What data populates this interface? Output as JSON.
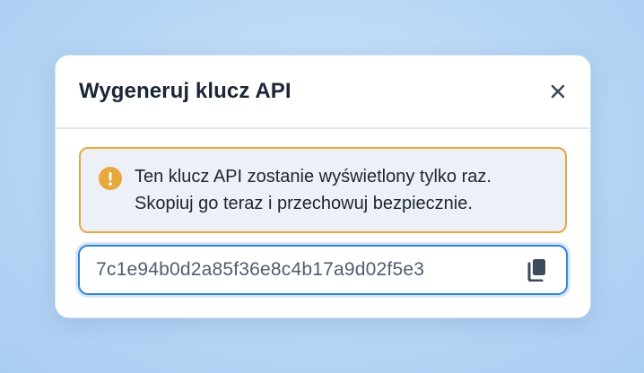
{
  "modal": {
    "title": "Wygeneruj klucz API",
    "close_icon": "close-icon",
    "warning": {
      "icon": "exclamation-circle-icon",
      "line1": "Ten klucz API zostanie wyświetlony tylko raz.",
      "line2": "Skopiuj go teraz i przechowuj bezpiecznie."
    },
    "api_key": {
      "value": "7c1e94b0d2a85f36e8c4b17a9d02f5e3",
      "copy_icon": "copy-icon"
    }
  },
  "colors": {
    "accent": "#2f86d6",
    "warning": "#e7a93c",
    "title": "#1b2536"
  }
}
